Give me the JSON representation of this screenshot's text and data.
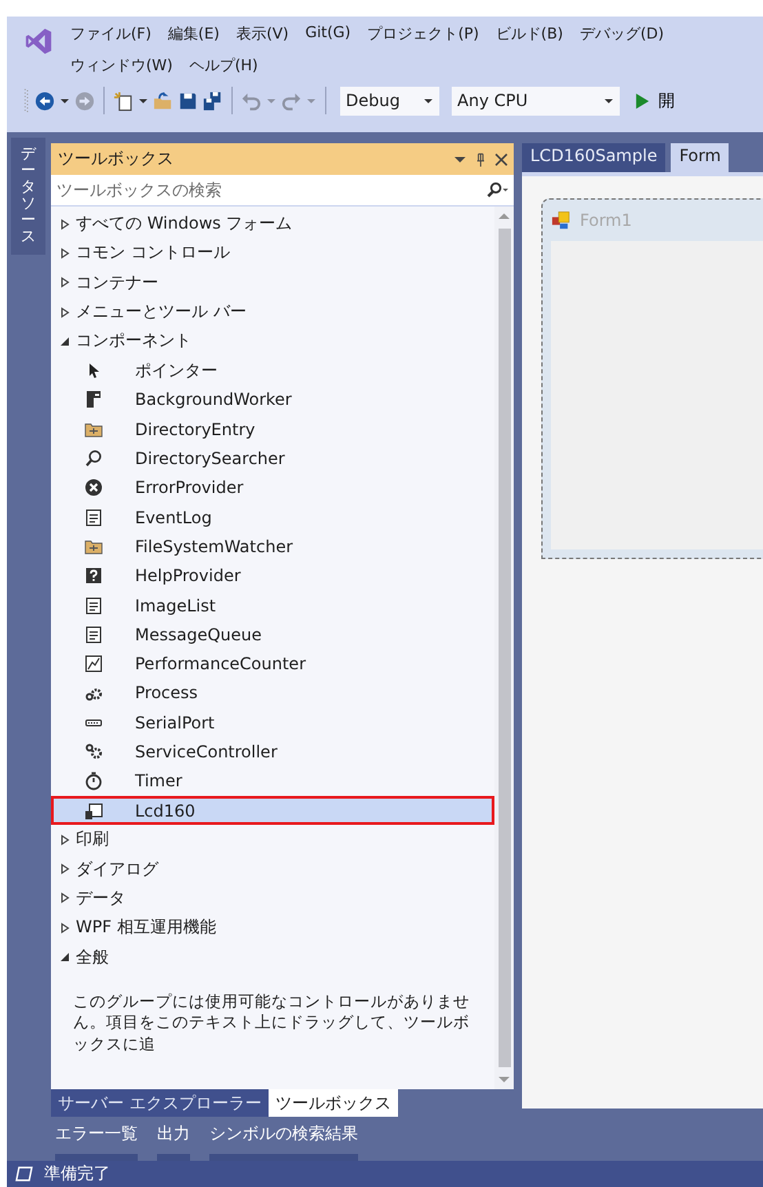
{
  "menu_bar": {
    "rows": [
      [
        "ファイル(F)",
        "編集(E)",
        "表示(V)",
        "Git(G)",
        "プロジェクト(P)",
        "ビルド(B)",
        "デバッグ(D)"
      ],
      [
        "ウィンドウ(W)",
        "ヘルプ(H)"
      ]
    ]
  },
  "toolbar": {
    "buttons": [
      {
        "kind": "back",
        "disabled": false
      },
      {
        "kind": "caret",
        "disabled": false
      },
      {
        "kind": "forward",
        "disabled": true
      },
      {
        "kind": "separator"
      },
      {
        "kind": "new",
        "disabled": false
      },
      {
        "kind": "caret",
        "disabled": false
      },
      {
        "kind": "open",
        "disabled": false
      },
      {
        "kind": "save",
        "disabled": false
      },
      {
        "kind": "saveall",
        "disabled": false
      },
      {
        "kind": "separator"
      },
      {
        "kind": "undo",
        "disabled": true
      },
      {
        "kind": "caret",
        "disabled": true
      },
      {
        "kind": "redo",
        "disabled": true
      },
      {
        "kind": "caret",
        "disabled": true
      },
      {
        "kind": "separator"
      }
    ],
    "configuration": "Debug",
    "platform": "Any CPU",
    "start_label": "開"
  },
  "side_tab": "データソース",
  "toolbox": {
    "title": "ツールボックス",
    "search": {
      "placeholder": "ツールボックスの検索"
    },
    "groups": [
      {
        "label": "すべての Windows フォーム",
        "expanded": false
      },
      {
        "label": "コモン コントロール",
        "expanded": false
      },
      {
        "label": "コンテナー",
        "expanded": false
      },
      {
        "label": "メニューとツール バー",
        "expanded": false
      },
      {
        "label": "コンポーネント",
        "expanded": true,
        "children": [
          {
            "label": "ポインター",
            "selected": false
          },
          {
            "label": "BackgroundWorker",
            "selected": false
          },
          {
            "label": "DirectoryEntry",
            "selected": false
          },
          {
            "label": "DirectorySearcher",
            "selected": false
          },
          {
            "label": "ErrorProvider",
            "selected": false
          },
          {
            "label": "EventLog",
            "selected": false
          },
          {
            "label": "FileSystemWatcher",
            "selected": false
          },
          {
            "label": "HelpProvider",
            "selected": false
          },
          {
            "label": "ImageList",
            "selected": false
          },
          {
            "label": "MessageQueue",
            "selected": false
          },
          {
            "label": "PerformanceCounter",
            "selected": false
          },
          {
            "label": "Process",
            "selected": false
          },
          {
            "label": "SerialPort",
            "selected": false
          },
          {
            "label": "ServiceController",
            "selected": false
          },
          {
            "label": "Timer",
            "selected": false
          },
          {
            "label": "Lcd160",
            "selected": true
          }
        ]
      },
      {
        "label": "印刷",
        "expanded": false
      },
      {
        "label": "ダイアログ",
        "expanded": false
      },
      {
        "label": "データ",
        "expanded": false
      },
      {
        "label": "WPF 相互運用機能",
        "expanded": false
      },
      {
        "label": "全般",
        "expanded": true,
        "empty_message": "このグループには使用可能なコントロールがありません。項目をこのテキスト上にドラッグして、ツールボックスに追"
      }
    ]
  },
  "panel_tabs": [
    {
      "label": "サーバー エクスプローラー",
      "selected": false
    },
    {
      "label": "ツールボックス",
      "selected": true
    }
  ],
  "document_tabs": [
    {
      "label": "LCD160Sample",
      "selected": false
    },
    {
      "label": "Form",
      "selected": true
    }
  ],
  "designer": {
    "form_title": "Form1"
  },
  "bottom_tabs": [
    "エラー一覧",
    "出力",
    "シンボルの検索結果"
  ],
  "status_bar": {
    "text": "準備完了"
  }
}
